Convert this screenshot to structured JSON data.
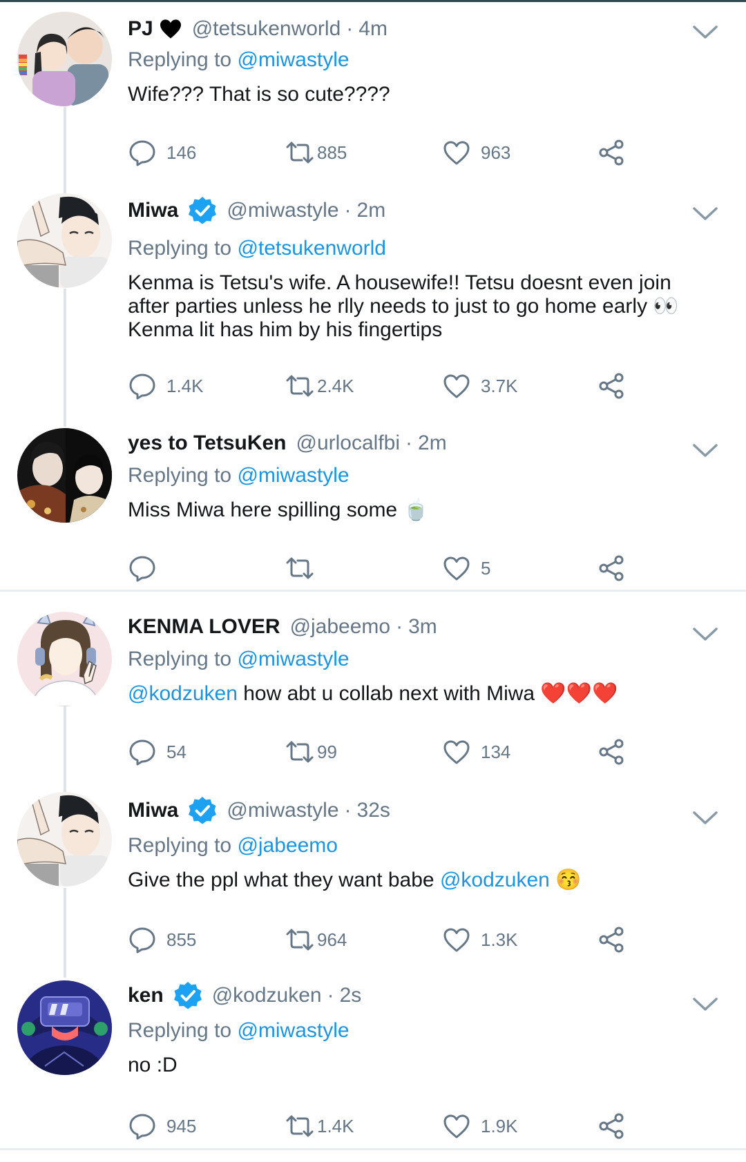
{
  "tweets": [
    {
      "name": "PJ",
      "handle": "@tetsukenworld",
      "dot": "·",
      "time": "4m",
      "replying_label": "Replying to",
      "replying_to": "@miwastyle",
      "text": "Wife??? That is so cute????",
      "replies": "146",
      "retweets": "885",
      "likes": "963"
    },
    {
      "name": "Miwa",
      "verified": true,
      "handle": "@miwastyle",
      "dot": "·",
      "time": "2m",
      "replying_label": "Replying to",
      "replying_to": "@tetsukenworld",
      "text": "Kenma is Tetsu's wife. A housewife!! Tetsu doesnt even join after parties unless he rlly needs to just to go home early 👀  Kenma lit has him by his fingertips",
      "replies": "1.4K",
      "retweets": "2.4K",
      "likes": "3.7K"
    },
    {
      "name": "yes to TetsuKen",
      "handle": "@urlocalfbi",
      "dot": "·",
      "time": "2m",
      "replying_label": "Replying to",
      "replying_to": "@miwastyle",
      "text": "Miss Miwa here spilling some 🍵",
      "replies": "",
      "retweets": "",
      "likes": "5"
    },
    {
      "name": "KENMA LOVER",
      "handle": "@jabeemo",
      "dot": "·",
      "time": "3m",
      "replying_label": "Replying to",
      "replying_to": "@miwastyle",
      "text_mention": "@kodzuken",
      "text": " how abt u collab next with Miwa ❤️❤️❤️",
      "replies": "54",
      "retweets": "99",
      "likes": "134"
    },
    {
      "name": "Miwa",
      "verified": true,
      "handle": "@miwastyle",
      "dot": "·",
      "time": "32s",
      "replying_label": "Replying to",
      "replying_to": "@jabeemo",
      "text": "Give the ppl what they want babe ",
      "text_mention": "@kodzuken",
      "text_tail": " 😚",
      "replies": "855",
      "retweets": "964",
      "likes": "1.3K"
    },
    {
      "name": "ken",
      "verified": true,
      "handle": "@kodzuken",
      "dot": "·",
      "time": "2s",
      "replying_label": "Replying to",
      "replying_to": "@miwastyle",
      "text": "no :D",
      "replies": "945",
      "retweets": "1.4K",
      "likes": "1.9K"
    }
  ],
  "colors": {
    "link": "#1b95e0",
    "secondary_text": "#657786",
    "verified": "#1da1f2",
    "divider": "#e6ecf0"
  },
  "icons": [
    "reply-icon",
    "retweet-icon",
    "like-icon",
    "share-icon",
    "chevron-down-icon",
    "verified-badge-icon"
  ]
}
